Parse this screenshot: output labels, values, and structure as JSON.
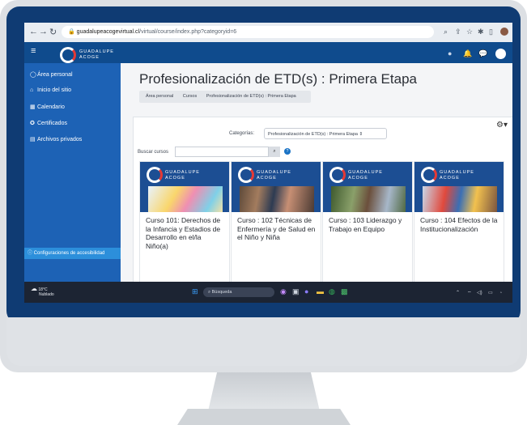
{
  "browser": {
    "url_host": "guadalupeacogevirtual.cl",
    "url_path": "/virtual/course/index.php?categoryid=6"
  },
  "header": {
    "logo_line1": "GUADALUPE",
    "logo_line2": "ACOGE"
  },
  "sidebar": {
    "items": [
      {
        "label": "Área personal",
        "icon": "user-circle-icon"
      },
      {
        "label": "Inicio del sitio",
        "icon": "home-icon"
      },
      {
        "label": "Calendario",
        "icon": "calendar-icon"
      },
      {
        "label": "Certificados",
        "icon": "certificate-icon"
      },
      {
        "label": "Archivos privados",
        "icon": "folder-icon"
      }
    ],
    "accessibility": "Configuraciones de accesibilidad"
  },
  "main": {
    "title": "Profesionalización de ETD(s) : Primera Etapa",
    "breadcrumb": [
      "Área personal",
      "Cursos",
      "Profesionalización de ETD(s) : Primera Etapa"
    ],
    "category_label": "Categorías:",
    "category_value": "Profesionalización de ETD(s) : Primera Etapa",
    "search_label": "Buscar cursos"
  },
  "courses": [
    {
      "title": "Curso 101: Derechos de la Infancia y Estadios de Desarrollo en el/la Niño(a)",
      "brand1": "GUADALUPE",
      "brand2": "ACOGE"
    },
    {
      "title": "Curso : 102 Técnicas de Enfermería y de Salud en el Niño y Niña",
      "brand1": "GUADALUPE",
      "brand2": "ACOGE"
    },
    {
      "title": "Curso : 103 Liderazgo y Trabajo en Equipo",
      "brand1": "GUADALUPE",
      "brand2": "ACOGE"
    },
    {
      "title": "Curso : 104 Efectos de la Institucionalización",
      "brand1": "GUADALUPE",
      "brand2": "ACOGE"
    }
  ],
  "taskbar": {
    "weather_temp": "18°C",
    "weather_desc": "Nublado",
    "search_placeholder": "Búsqueda"
  },
  "colors": {
    "header_blue": "#0f4b8d",
    "sidebar_blue": "#1d62b5",
    "accessibility_blue": "#2c8fdb",
    "logo_red": "#e53935"
  }
}
